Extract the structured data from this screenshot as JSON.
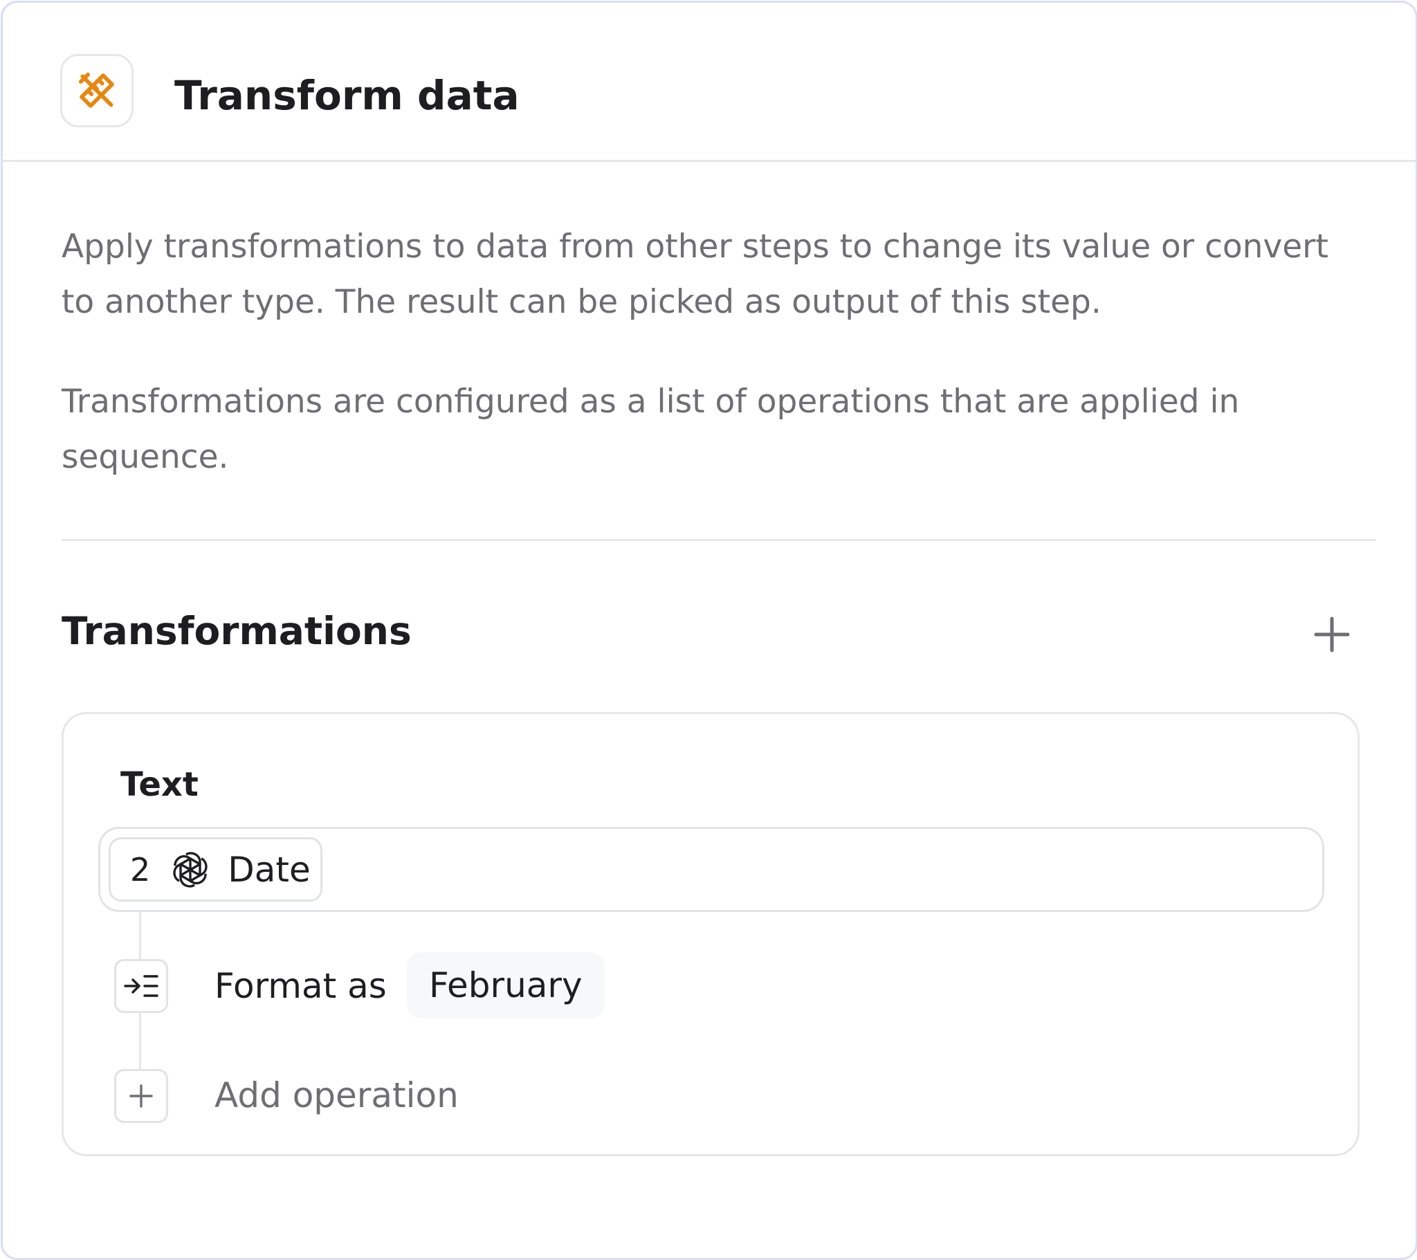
{
  "header": {
    "title": "Transform data",
    "icon": "ruler-pencil-icon",
    "icon_color": "#e8860f"
  },
  "description": {
    "paragraph_1": "Apply transformations to data from other steps to change its value or convert to another type. The result can be picked as output of this step.",
    "paragraph_2": "Transformations are configured as a list of operations that are applied in sequence."
  },
  "transformations": {
    "title": "Transformations",
    "add_icon": "plus-icon",
    "items": [
      {
        "label": "Text",
        "source": {
          "step_number": "2",
          "icon": "openai-icon",
          "label": "Date"
        },
        "operations": [
          {
            "icon": "indent-list-icon",
            "label": "Format as",
            "value": "February"
          }
        ],
        "add_operation_label": "Add operation"
      }
    ]
  }
}
